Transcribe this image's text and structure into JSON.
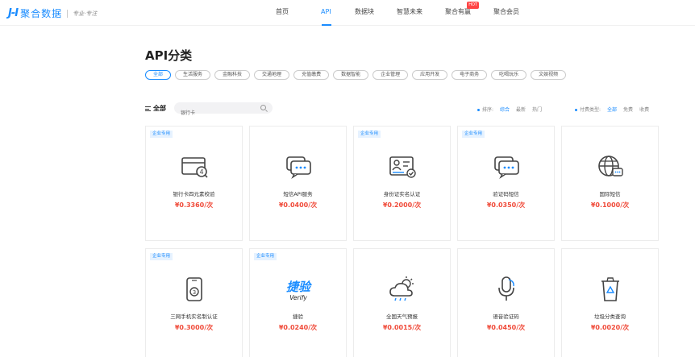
{
  "header": {
    "logo_mark": "J-I",
    "logo_text": "聚合数据",
    "slogan": "专业·专注",
    "nav": [
      {
        "label": "首页"
      },
      {
        "label": "API"
      },
      {
        "label": "数据块"
      },
      {
        "label": "智慧未来"
      },
      {
        "label": "聚合有赢"
      },
      {
        "label": "聚合会员"
      }
    ],
    "hot_badge": "HOT"
  },
  "section_title": "API分类",
  "categories": [
    "全部",
    "生活服务",
    "金融科技",
    "交通地理",
    "充值缴费",
    "数据智能",
    "企业管理",
    "应用开发",
    "电子商务",
    "吃喝玩乐",
    "文娱视频"
  ],
  "filter": {
    "all_label": "全部",
    "search_value": "银行卡",
    "sort_label": "排序:",
    "sort_options": [
      "综合",
      "最新",
      "热门"
    ],
    "pay_label": "付费类型:",
    "pay_options": [
      "全部",
      "免费",
      "收费"
    ]
  },
  "cards": [
    {
      "tag": "企业专用",
      "name": "银行卡四元素校验",
      "price": "¥0.3360/次",
      "icon": "bank-card-icon"
    },
    {
      "tag": "",
      "name": "短信API服务",
      "price": "¥0.0400/次",
      "icon": "sms-chat-icon"
    },
    {
      "tag": "企业专用",
      "name": "身份证实名认证",
      "price": "¥0.2000/次",
      "icon": "id-card-icon"
    },
    {
      "tag": "企业专用",
      "name": "验证码短信",
      "price": "¥0.0350/次",
      "icon": "sms-code-icon"
    },
    {
      "tag": "",
      "name": "国际短信",
      "price": "¥0.1000/次",
      "icon": "globe-sms-icon"
    },
    {
      "tag": "企业专用",
      "name": "三网手机实名制认证",
      "price": "¥0.3000/次",
      "icon": "phone-verify-icon"
    },
    {
      "tag": "企业专用",
      "name": "捷验",
      "price": "¥0.0240/次",
      "icon": "jieyan-verify-logo",
      "logo_cn": "捷验",
      "logo_en": "Verify"
    },
    {
      "tag": "",
      "name": "全国天气预报",
      "price": "¥0.0015/次",
      "icon": "weather-icon"
    },
    {
      "tag": "",
      "name": "语音验证码",
      "price": "¥0.0450/次",
      "icon": "microphone-icon"
    },
    {
      "tag": "",
      "name": "垃圾分类查询",
      "price": "¥0.0020/次",
      "icon": "trash-bin-icon"
    }
  ],
  "colors": {
    "accent": "#1a8cff",
    "price": "#f04b3a",
    "hot": "#ff4444"
  }
}
